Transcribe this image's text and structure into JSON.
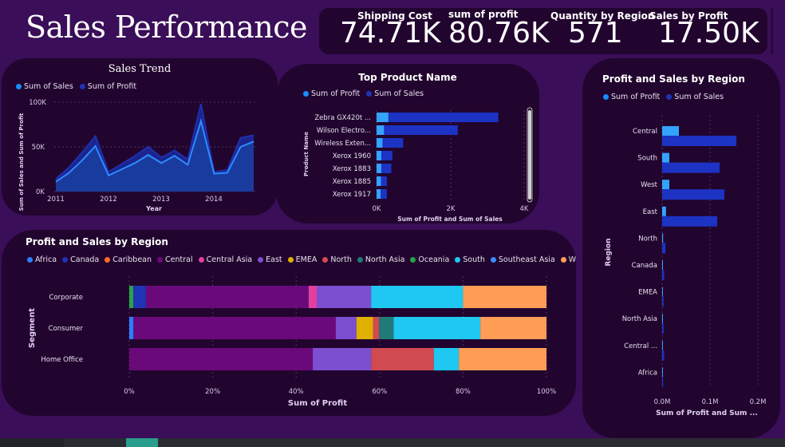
{
  "header": {
    "title": "Sales Performance"
  },
  "kpis": [
    {
      "label": "Shipping Cost",
      "value": "74.71K"
    },
    {
      "label": "sum of profit",
      "value": "80.76K"
    },
    {
      "label": "Quantity by Region",
      "value": "571"
    },
    {
      "label": "Sales by Profit",
      "value": "17.50K"
    }
  ],
  "colors": {
    "background": "#3a0e58",
    "panel": "#22052f",
    "profit": "#1a8cff",
    "sales": "#1f33b5",
    "region_profit": "#33a3ff",
    "region_sales": "#1c33c4",
    "africa": "#2a7fff",
    "canada": "#1f33b5",
    "caribbean": "#ff6a2b",
    "central": "#6a0a7a",
    "central_asia": "#e040a0",
    "east": "#7b4fd0",
    "emea": "#e0b000",
    "north": "#d04b50",
    "north_asia": "#1f7a78",
    "oceania": "#26a34a",
    "south": "#1ec8f0",
    "southeast_asia": "#3a8cff",
    "west": "#ff9c55"
  },
  "sales_trend": {
    "title": "Sales Trend",
    "legend": [
      "Sum of Sales",
      "Sum of Profit"
    ],
    "ylabel": "Sum of Sales and Sum of Profit",
    "xlabel": "Year",
    "yticks": [
      "100K",
      "50K",
      "0K"
    ],
    "xticks": [
      "2011",
      "2012",
      "2013",
      "2014"
    ]
  },
  "top_product": {
    "title": "Top Product Name",
    "legend": [
      "Sum of Profit",
      "Sum of Sales"
    ],
    "ylabel": "Product Name",
    "xlabel": "Sum of Profit and Sum of Sales",
    "xticks": [
      "0K",
      "2K",
      "4K"
    ]
  },
  "region_segment": {
    "title": "Profit and Sales by Region",
    "legend": [
      "Africa",
      "Canada",
      "Caribbean",
      "Central",
      "Central Asia",
      "East",
      "EMEA",
      "North",
      "North Asia",
      "Oceania",
      "South",
      "Southeast Asia",
      "West"
    ],
    "ylabel": "Segment",
    "xlabel": "Sum of Profit",
    "xticks": [
      "0%",
      "20%",
      "40%",
      "60%",
      "80%",
      "100%"
    ]
  },
  "region_right": {
    "title": "Profit and Sales by Region",
    "legend": [
      "Sum of Profit",
      "Sum of Sales"
    ],
    "ylabel": "Region",
    "xlabel": "Sum of Profit and Sum ...",
    "xticks": [
      "0.0M",
      "0.1M",
      "0.2M"
    ]
  },
  "chart_data": [
    {
      "type": "area",
      "title": "Sales Trend",
      "xlabel": "Year",
      "ylabel": "Sum of Sales and Sum of Profit",
      "ylim": [
        0,
        110000
      ],
      "x": [
        "2011-01",
        "2011-04",
        "2011-07",
        "2011-10",
        "2012-01",
        "2012-04",
        "2012-07",
        "2012-10",
        "2013-01",
        "2013-04",
        "2013-07",
        "2013-10",
        "2014-01",
        "2014-04",
        "2014-07",
        "2014-10"
      ],
      "series": [
        {
          "name": "Sum of Sales",
          "values": [
            14000,
            27000,
            44000,
            62000,
            22000,
            31000,
            40000,
            50000,
            38000,
            46000,
            36000,
            98000,
            22000,
            24000,
            60000,
            63000
          ]
        },
        {
          "name": "Sum of Profit",
          "values": [
            11000,
            21000,
            35000,
            51000,
            18000,
            25000,
            32000,
            41000,
            32000,
            40000,
            30000,
            79000,
            20000,
            21000,
            50000,
            56000
          ]
        }
      ]
    },
    {
      "type": "bar",
      "title": "Top Product Name",
      "xlabel": "Sum of Profit and Sum of Sales",
      "ylabel": "Product Name",
      "xlim": [
        0,
        4200
      ],
      "categories": [
        "Zebra GX420t ...",
        "Wilson Electro...",
        "Wireless Exten...",
        "Xerox 1960",
        "Xerox 1883",
        "Xerox 1885",
        "Xerox 1917"
      ],
      "series": [
        {
          "name": "Sum of Profit",
          "values": [
            320,
            200,
            160,
            130,
            130,
            120,
            110
          ]
        },
        {
          "name": "Sum of Sales",
          "values": [
            3300,
            2200,
            720,
            430,
            400,
            280,
            280
          ]
        }
      ]
    },
    {
      "type": "bar",
      "title": "Profit and Sales by Region",
      "xlabel": "Sum of Profit",
      "ylabel": "Segment",
      "stacked_percent": true,
      "categories": [
        "Corporate",
        "Consumer",
        "Home Office"
      ],
      "series": [
        {
          "name": "Oceania",
          "values": [
            1,
            0,
            0
          ]
        },
        {
          "name": "Canada",
          "values": [
            3,
            0,
            0
          ]
        },
        {
          "name": "Africa",
          "values": [
            0,
            1,
            0
          ]
        },
        {
          "name": "Central",
          "values": [
            39,
            49,
            44
          ]
        },
        {
          "name": "Central Asia",
          "values": [
            2,
            0,
            0
          ]
        },
        {
          "name": "East",
          "values": [
            13,
            5,
            14
          ]
        },
        {
          "name": "EMEA",
          "values": [
            0,
            4,
            0
          ]
        },
        {
          "name": "North",
          "values": [
            0,
            1.5,
            15
          ]
        },
        {
          "name": "North Asia",
          "values": [
            0,
            3.5,
            0
          ]
        },
        {
          "name": "South",
          "values": [
            22,
            21,
            6
          ]
        },
        {
          "name": "West",
          "values": [
            20,
            16,
            21
          ]
        }
      ]
    },
    {
      "type": "bar",
      "title": "Profit and Sales by Region",
      "xlabel": "Sum of Profit and Sum ...",
      "ylabel": "Region",
      "xlim": [
        0,
        0.2
      ],
      "categories": [
        "Central",
        "South",
        "West",
        "East",
        "North",
        "Canada",
        "EMEA",
        "North Asia",
        "Central ...",
        "Africa"
      ],
      "series": [
        {
          "name": "Sum of Profit",
          "values": [
            0.035,
            0.015,
            0.015,
            0.008,
            0.002,
            0.0008,
            0.0005,
            0.0004,
            0.0003,
            0.0002
          ]
        },
        {
          "name": "Sum of Sales",
          "values": [
            0.155,
            0.12,
            0.13,
            0.115,
            0.007,
            0.004,
            0.003,
            0.003,
            0.004,
            0.002
          ]
        }
      ]
    }
  ]
}
